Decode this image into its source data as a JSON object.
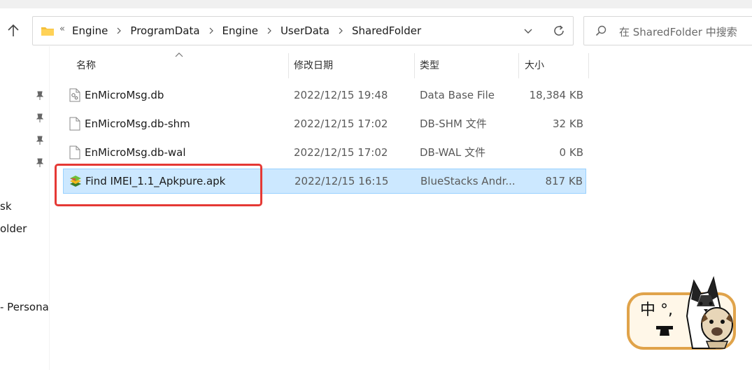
{
  "address_bar": {
    "overflow": "«",
    "crumbs": [
      "Engine",
      "ProgramData",
      "Engine",
      "UserData",
      "SharedFolder"
    ]
  },
  "search": {
    "placeholder": "在 SharedFolder 中搜索"
  },
  "nav_pane": {
    "items": [
      "sk",
      "older",
      "- Persona"
    ]
  },
  "columns": {
    "name": "名称",
    "date": "修改日期",
    "type": "类型",
    "size": "大小"
  },
  "files": [
    {
      "name": "EnMicroMsg.db",
      "date": "2022/12/15 19:48",
      "type": "Data Base File",
      "size": "18,384 KB",
      "icon": "database-file-icon"
    },
    {
      "name": "EnMicroMsg.db-shm",
      "date": "2022/12/15 17:02",
      "type": "DB-SHM 文件",
      "size": "32 KB",
      "icon": "blank-file-icon"
    },
    {
      "name": "EnMicroMsg.db-wal",
      "date": "2022/12/15 17:02",
      "type": "DB-WAL 文件",
      "size": "0 KB",
      "icon": "blank-file-icon"
    },
    {
      "name": "Find IMEI_1.1_Apkpure.apk",
      "date": "2022/12/15 16:15",
      "type": "BlueStacks Andr...",
      "size": "817 KB",
      "icon": "bluestacks-apk-icon",
      "selected": true
    }
  ],
  "sticker": {
    "text": "中 °,"
  },
  "colors": {
    "selection": "#cce8ff",
    "annotation": "#e53935",
    "folder": "#f5c03a"
  }
}
